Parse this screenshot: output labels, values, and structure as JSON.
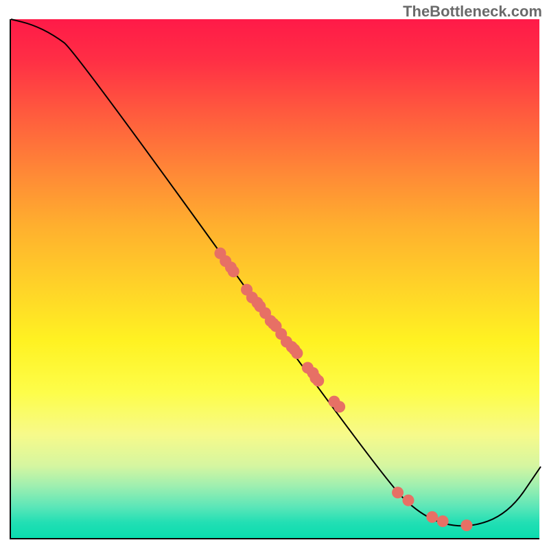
{
  "watermark": "TheBottleneck.com",
  "chart_data": {
    "type": "line",
    "title": "",
    "xlabel": "",
    "ylabel": "",
    "xlim": [
      0,
      100
    ],
    "ylim": [
      0,
      100
    ],
    "grid": false,
    "legend": false,
    "curve": {
      "x": [
        0,
        4,
        8,
        12,
        70,
        78,
        86,
        94,
        100
      ],
      "y": [
        100,
        99,
        97,
        94,
        12,
        4,
        2,
        5,
        14
      ],
      "note": "values estimated from pixel positions; y is normalized 0-100 where 0 is bottom green band and 100 is top"
    },
    "markers": {
      "x": [
        39.5,
        40.5,
        41.5,
        42.0,
        44.5,
        45.5,
        46.5,
        47.0,
        48.0,
        49.0,
        49.5,
        50.0,
        51.0,
        52.0,
        53.0,
        53.5,
        54.0,
        56.0,
        57.0,
        57.5,
        58.0,
        61.0,
        62.0,
        73.0,
        75.0,
        79.5,
        81.5,
        86.0
      ],
      "y": [
        55.0,
        53.5,
        52.3,
        51.5,
        48.0,
        46.5,
        45.5,
        44.8,
        43.5,
        42.0,
        41.5,
        41.0,
        39.5,
        38.0,
        37.0,
        36.5,
        35.8,
        33.0,
        32.0,
        31.0,
        30.5,
        26.5,
        25.5,
        9.0,
        7.5,
        4.3,
        3.5,
        2.7
      ],
      "note": "scatter points along the curve; y normalized 0-100"
    }
  }
}
